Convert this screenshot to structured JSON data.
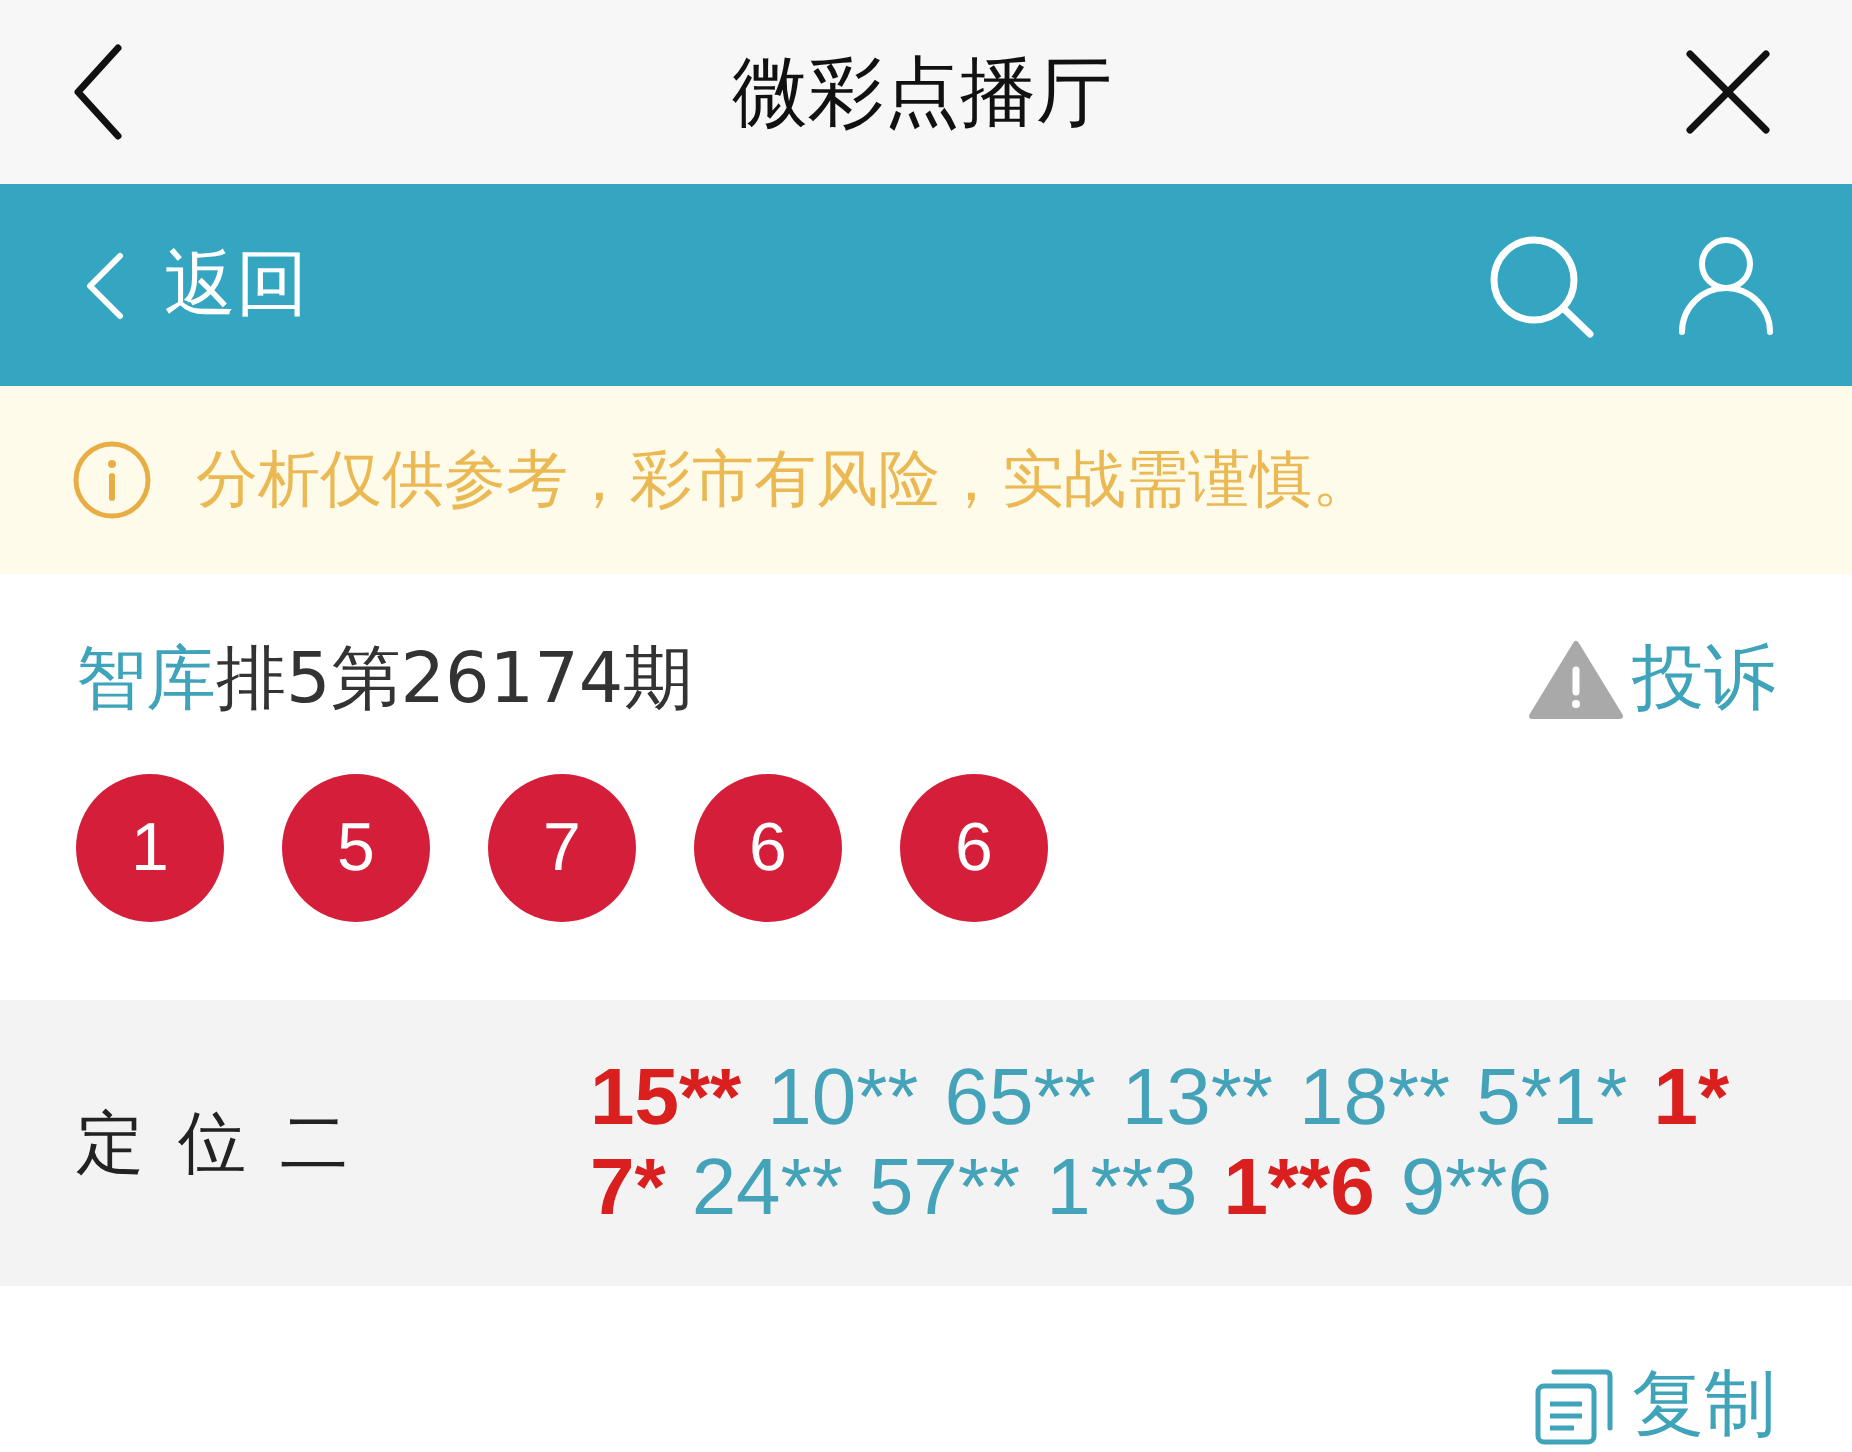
{
  "nav_bar": {
    "title": "微彩点播厅"
  },
  "header_bar": {
    "back_label": "返回"
  },
  "notice": {
    "text": "分析仅供参考，彩市有风险，实战需谨慎。"
  },
  "issue": {
    "source": "智库",
    "title": "排5第26174期",
    "report_label": "投诉"
  },
  "draw_numbers": [
    "1",
    "5",
    "7",
    "6",
    "6"
  ],
  "prediction": {
    "label": "定位二",
    "picks": [
      {
        "text": "15**",
        "hit": true
      },
      {
        "text": "10**",
        "hit": false
      },
      {
        "text": "65**",
        "hit": false
      },
      {
        "text": "13**",
        "hit": false
      },
      {
        "text": "18**",
        "hit": false
      },
      {
        "text": "5*1*",
        "hit": false
      },
      {
        "text": "1*",
        "hit": true
      },
      {
        "text": "7*",
        "hit": true
      },
      {
        "text": "24**",
        "hit": false
      },
      {
        "text": "57**",
        "hit": false
      },
      {
        "text": "1**3",
        "hit": false
      },
      {
        "text": "1**6",
        "hit": true
      },
      {
        "text": "9**6",
        "hit": false
      }
    ]
  },
  "copy_button": {
    "label": "复制"
  }
}
